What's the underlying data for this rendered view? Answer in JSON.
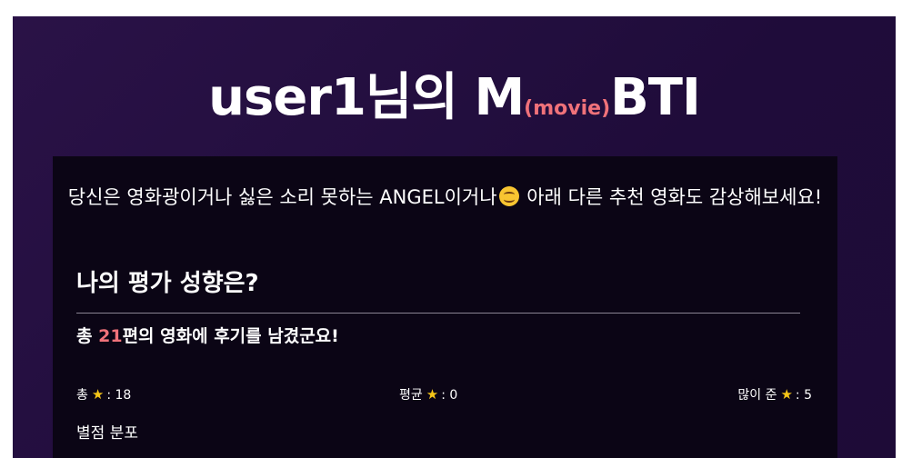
{
  "header": {
    "user": "user1",
    "title_suffix": "님의 M",
    "movie_word": "(movie)",
    "title_end": "BTI"
  },
  "intro": {
    "line_before_emoji": "당신은 영화광이거나 싫은 소리 못하는 ANGEL이거나",
    "emoji_icon": "smiling-face-icon",
    "line_after_emoji": "아래 다른 추천 영화도 감상해보세요!"
  },
  "tendency": {
    "heading": "나의 평가 성향은?",
    "summary_prefix": "총",
    "review_count": "21",
    "summary_suffix": "편의 영화에 후기를 남겼군요!",
    "stats": {
      "total_label": "총",
      "total_value": ": 18",
      "average_label": "평균",
      "average_value": ": 0",
      "most_label": "많이 준",
      "most_value": ": 5",
      "star_glyph": "★"
    },
    "distribution_label": "별점 분포"
  },
  "colors": {
    "accent": "#f0727a",
    "star": "#f5c518",
    "background": "#1f0c3a",
    "card": "#0b0515"
  }
}
